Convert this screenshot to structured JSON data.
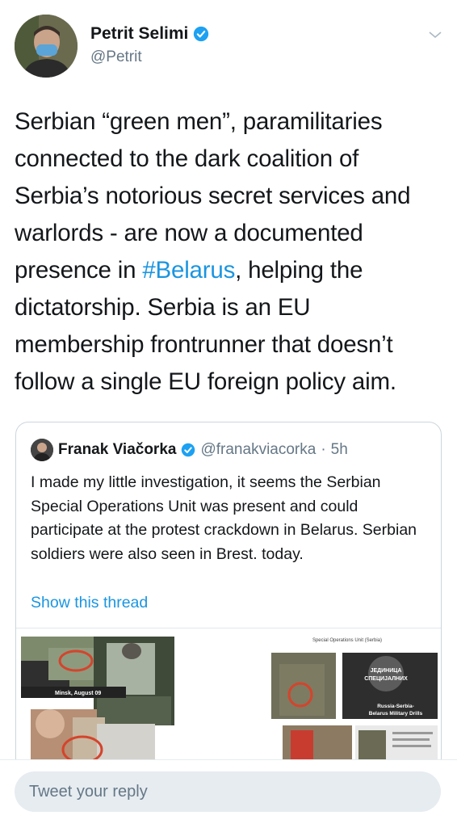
{
  "tweet": {
    "author_name": "Petrit Selimi",
    "author_handle": "@Petrit",
    "text_before_tag": "Serbian “green men”, paramilitaries connected to the dark coalition of Serbia’s notorious secret services and warlords - are now a documented presence in ",
    "hashtag": "#Belarus",
    "text_after_tag": ", helping the dictatorship. Serbia is an EU membership frontrunner that doesn’t follow a single EU foreign policy aim."
  },
  "quote": {
    "author_name": "Franak Viačorka",
    "author_handle": "@franakviacorka",
    "separator": "·",
    "time": "5h",
    "text": "I made my little investigation, it seems the Serbian Special Operations Unit was present and could participate at the protest crackdown in Belarus. Serbian soldiers were also seen in Brest. today.",
    "show_thread": "Show this thread",
    "media": {
      "caption_left": "Minsk, August 09",
      "header_right": "Special Operations Unit (Serbia)",
      "badge_text_1": "ЈЕДИНИЦА",
      "badge_text_2": "СПЕЦИЈАЛНИХ",
      "caption_right_1": "Russia-Serbia-",
      "caption_right_2": "Belarus Military Drills"
    }
  },
  "reply": {
    "placeholder": "Tweet your reply"
  },
  "colors": {
    "link": "#1b95e0",
    "verified": "#1da1f2",
    "muted": "#657786"
  }
}
